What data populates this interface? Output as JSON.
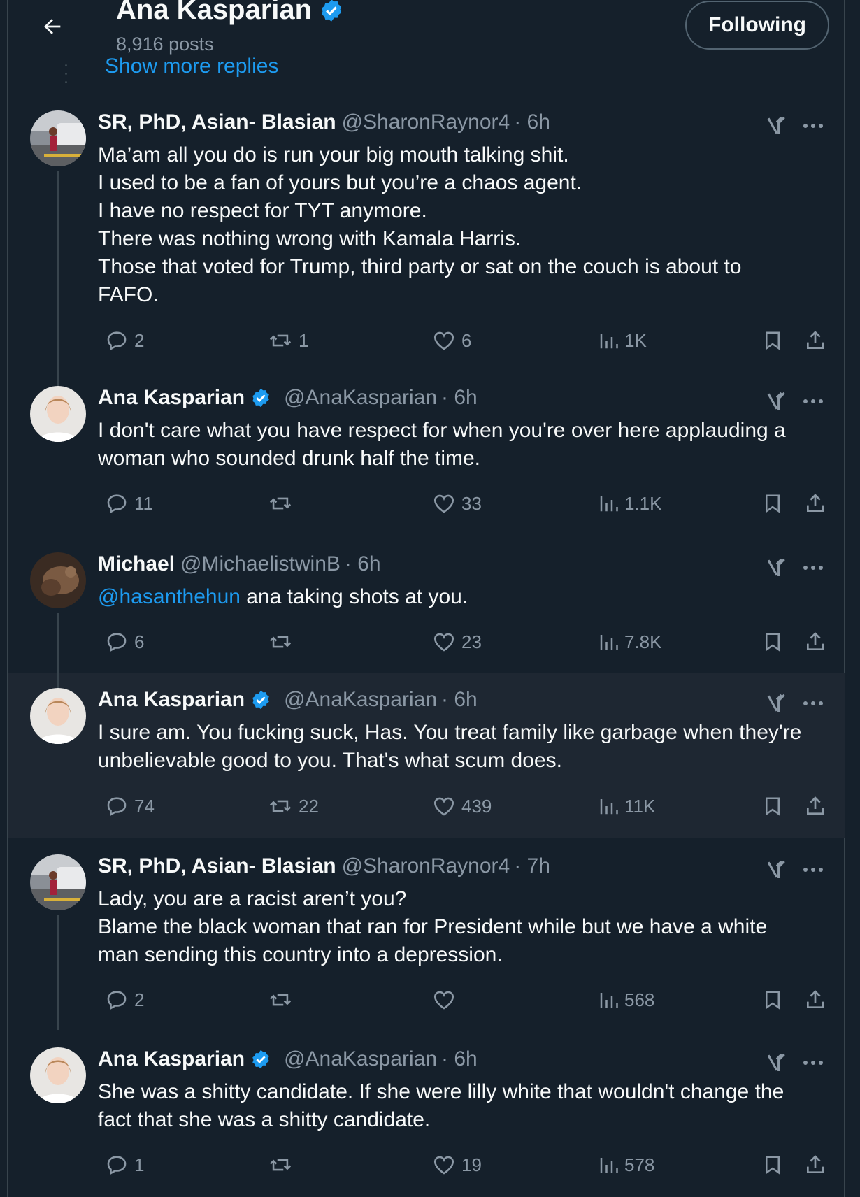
{
  "header": {
    "title": "Ana Kasparian",
    "post_count": "8,916 posts",
    "follow_label": "Following",
    "show_more": "Show more replies"
  },
  "tweets": [
    {
      "name": "SR, PhD, Asian- Blasian",
      "verified": false,
      "handle": "@SharonRaynor4",
      "time": "· 6h",
      "lines": [
        "Ma’am all you do is run your big mouth talking shit.",
        "I used to be a fan of yours but you’re a chaos agent.",
        "I have no respect for TYT anymore.",
        "There was nothing wrong with Kamala Harris.",
        "Those that voted for Trump, third party or sat on the couch is about to",
        "FAFO."
      ],
      "replies": "2",
      "reposts": "1",
      "likes": "6",
      "views": "1K"
    },
    {
      "name": "Ana Kasparian",
      "verified": true,
      "handle": "@AnaKasparian",
      "time": "· 6h",
      "lines": [
        "I don't care what you have respect for when you're over here applauding a",
        "woman who sounded drunk half the time."
      ],
      "replies": "11",
      "reposts": "",
      "likes": "33",
      "views": "1.1K"
    },
    {
      "name": "Michael",
      "verified": false,
      "handle": "@MichaelistwinB",
      "time": "· 6h",
      "mention": "@hasanthehun",
      "lines": [
        " ana taking shots at you."
      ],
      "replies": "6",
      "reposts": "",
      "likes": "23",
      "views": "7.8K"
    },
    {
      "name": "Ana Kasparian",
      "verified": true,
      "handle": "@AnaKasparian",
      "time": "· 6h",
      "lines": [
        "I sure am. You fucking suck, Has. You treat family like garbage when they're",
        "unbelievable good to you. That's what scum does."
      ],
      "replies": "74",
      "reposts": "22",
      "likes": "439",
      "views": "11K"
    },
    {
      "name": "SR, PhD, Asian- Blasian",
      "verified": false,
      "handle": "@SharonRaynor4",
      "time": "· 7h",
      "lines": [
        "Lady, you are a racist aren’t you?",
        "Blame the black woman that ran for President while but we have a white",
        "man sending this country into a depression."
      ],
      "replies": "2",
      "reposts": "",
      "likes": "",
      "views": "568"
    },
    {
      "name": "Ana Kasparian",
      "verified": true,
      "handle": "@AnaKasparian",
      "time": "· 6h",
      "lines": [
        "She was a shitty candidate. If she were lilly white that wouldn't change the",
        "fact that she was a shitty candidate."
      ],
      "replies": "1",
      "reposts": "",
      "likes": "19",
      "views": "578"
    }
  ],
  "icons": {
    "back": "arrow-left-icon",
    "verified": "verified-badge-icon",
    "grok": "grok-icon",
    "more": "more-horizontal-icon",
    "reply": "reply-icon",
    "repost": "repost-icon",
    "like": "heart-icon",
    "views": "views-icon",
    "bookmark": "bookmark-icon",
    "share": "share-icon"
  },
  "colors": {
    "background": "#15202b",
    "highlight": "#1e2732",
    "accent": "#1d9bf0",
    "secondary_text": "#8b98a5"
  }
}
